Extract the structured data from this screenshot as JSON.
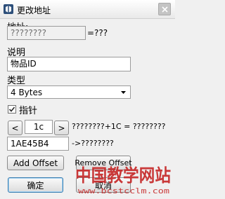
{
  "window": {
    "title": "更改地址"
  },
  "address": {
    "label": "地址:",
    "value": "????????",
    "result": "=???"
  },
  "description": {
    "label": "说明",
    "value": "物品ID"
  },
  "type": {
    "label": "类型",
    "selected": "4 Bytes"
  },
  "pointer": {
    "label": "指针",
    "checked": true,
    "offset_value": "1c",
    "offset_result": "????????+1C = ????????",
    "base_value": "1AE45B4",
    "base_result": "->????????"
  },
  "buttons": {
    "add_offset": "Add Offset",
    "remove_offset": "Remove Offset",
    "ok": "确定",
    "cancel": "取消",
    "prev": "<",
    "next": ">"
  },
  "watermark": {
    "text": "中国教学网站",
    "url": "www.bcstcclm.com"
  }
}
